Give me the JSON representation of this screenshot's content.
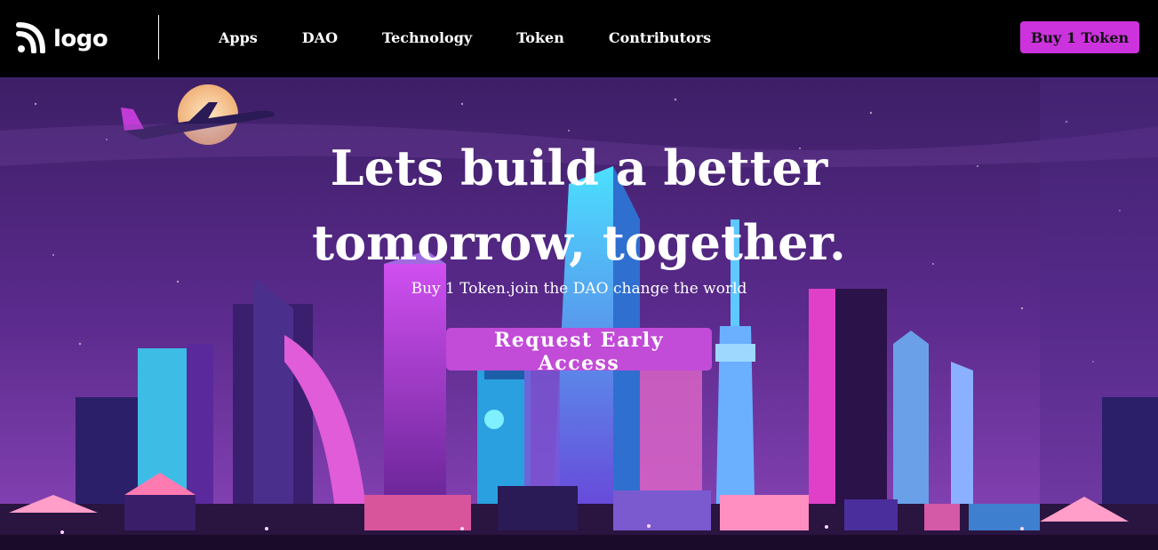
{
  "brand": {
    "logo_text": "logo",
    "logo_icon": "rss-feed-icon"
  },
  "nav": {
    "items": [
      "Apps",
      "DAO",
      "Technology",
      "Token",
      "Contributors"
    ],
    "buy_label": "Buy 1 Token"
  },
  "hero": {
    "headline_line1": "Lets build a better",
    "headline_line2": "tomorrow, together.",
    "subtitle": "Buy 1 Token.join the DAO change the world",
    "cta_label": "Request Early Access"
  },
  "colors": {
    "accent": "#cc33dd",
    "sky_top": "#3a1d63",
    "sky_bottom": "#7a3ea8",
    "neon_cyan": "#39d6ff",
    "neon_pink": "#ff4fd8"
  }
}
